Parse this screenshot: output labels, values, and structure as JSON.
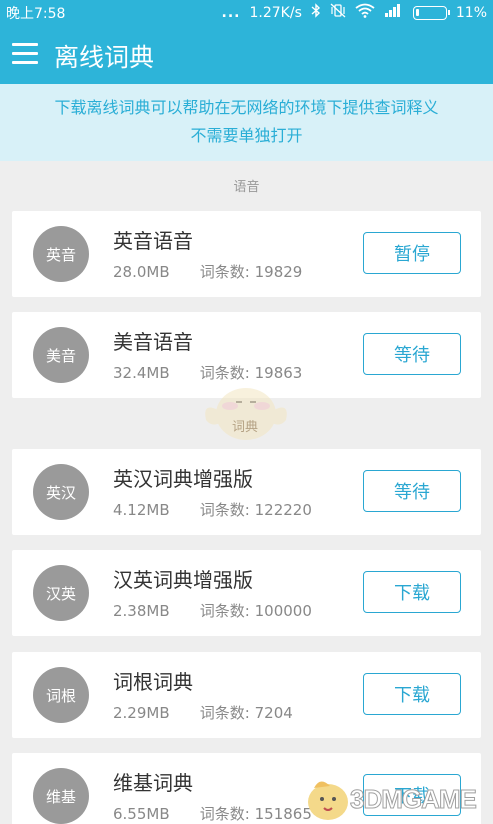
{
  "status_bar": {
    "time": "晚上7:58",
    "dots": "...",
    "network_speed": "1.27K/s",
    "battery_percent": "11%",
    "battery_level": 0.11,
    "icons": [
      "bluetooth-icon",
      "vibrate-off-icon",
      "wifi-icon",
      "signal-icon",
      "battery-icon"
    ]
  },
  "app_bar": {
    "title": "离线词典",
    "menu_icon": "menu-icon"
  },
  "notice": {
    "line1": "下载离线词典可以帮助在无网络的环境下提供查词释义",
    "line2": "不需要单独打开"
  },
  "section": {
    "label": "语音"
  },
  "dictionaries": [
    {
      "badge": "英音",
      "name": "英音语音",
      "size": "28.0MB",
      "entries": "词条数: 19829",
      "action": "暂停"
    },
    {
      "badge": "美音",
      "name": "美音语音",
      "size": "32.4MB",
      "entries": "词条数: 19863",
      "action": "等待"
    },
    {
      "badge": "英汉",
      "name": "英汉词典增强版",
      "size": "4.12MB",
      "entries": "词条数: 122220",
      "action": "等待"
    },
    {
      "badge": "汉英",
      "name": "汉英词典增强版",
      "size": "2.38MB",
      "entries": "词条数: 100000",
      "action": "下载"
    },
    {
      "badge": "词根",
      "name": "词根词典",
      "size": "2.29MB",
      "entries": "词条数: 7204",
      "action": "下载"
    },
    {
      "badge": "维基",
      "name": "维基词典",
      "size": "6.55MB",
      "entries": "词条数: 151865",
      "action": "下载"
    }
  ],
  "watermark": {
    "mascot_label": "词典",
    "logo_text": "3DMGAME"
  },
  "colors": {
    "primary": "#2db4d9",
    "notice_bg": "#d8f1f8",
    "notice_text": "#2aaed6",
    "button_border": "#2aa7d2",
    "badge_bg": "#9a9a9a",
    "page_bg": "#eeeeee"
  }
}
